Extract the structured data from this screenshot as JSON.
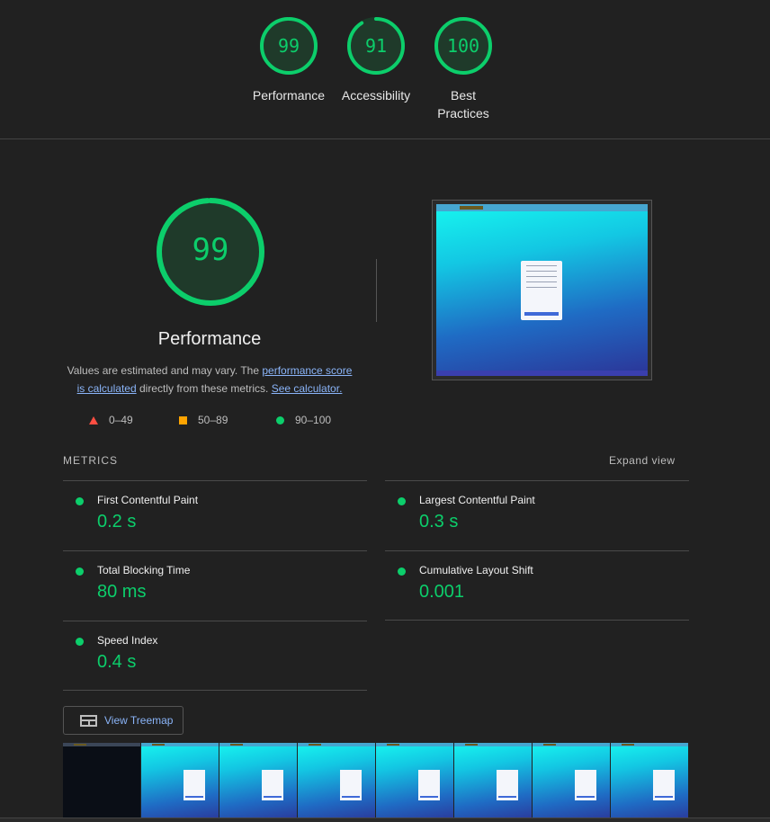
{
  "top_scores": [
    {
      "score": "99",
      "label": "Performance",
      "fraction": 0.99
    },
    {
      "score": "91",
      "label": "Accessibility",
      "fraction": 0.91
    },
    {
      "score": "100",
      "label": "Best Practices",
      "fraction": 1.0
    }
  ],
  "performance": {
    "score": "99",
    "fraction": 0.99,
    "title": "Performance",
    "desc_part1": "Values are estimated and may vary. The ",
    "link_score": "performance score is calculated",
    "desc_part2": " directly from these metrics. ",
    "link_calc": "See calculator."
  },
  "legend": {
    "fail": "0–49",
    "average": "50–89",
    "pass": "90–100"
  },
  "metrics": {
    "heading": "METRICS",
    "expand": "Expand view",
    "items": [
      {
        "name": "First Contentful Paint",
        "value": "0.2 s"
      },
      {
        "name": "Largest Contentful Paint",
        "value": "0.3 s"
      },
      {
        "name": "Total Blocking Time",
        "value": "80 ms"
      },
      {
        "name": "Cumulative Layout Shift",
        "value": "0.001"
      },
      {
        "name": "Speed Index",
        "value": "0.4 s"
      }
    ]
  },
  "treemap_button": "View Treemap",
  "colors": {
    "pass": "#0cce6b",
    "average": "#ffa400",
    "fail": "#ff4e42",
    "link": "#8ab4f8",
    "background": "#212121"
  }
}
